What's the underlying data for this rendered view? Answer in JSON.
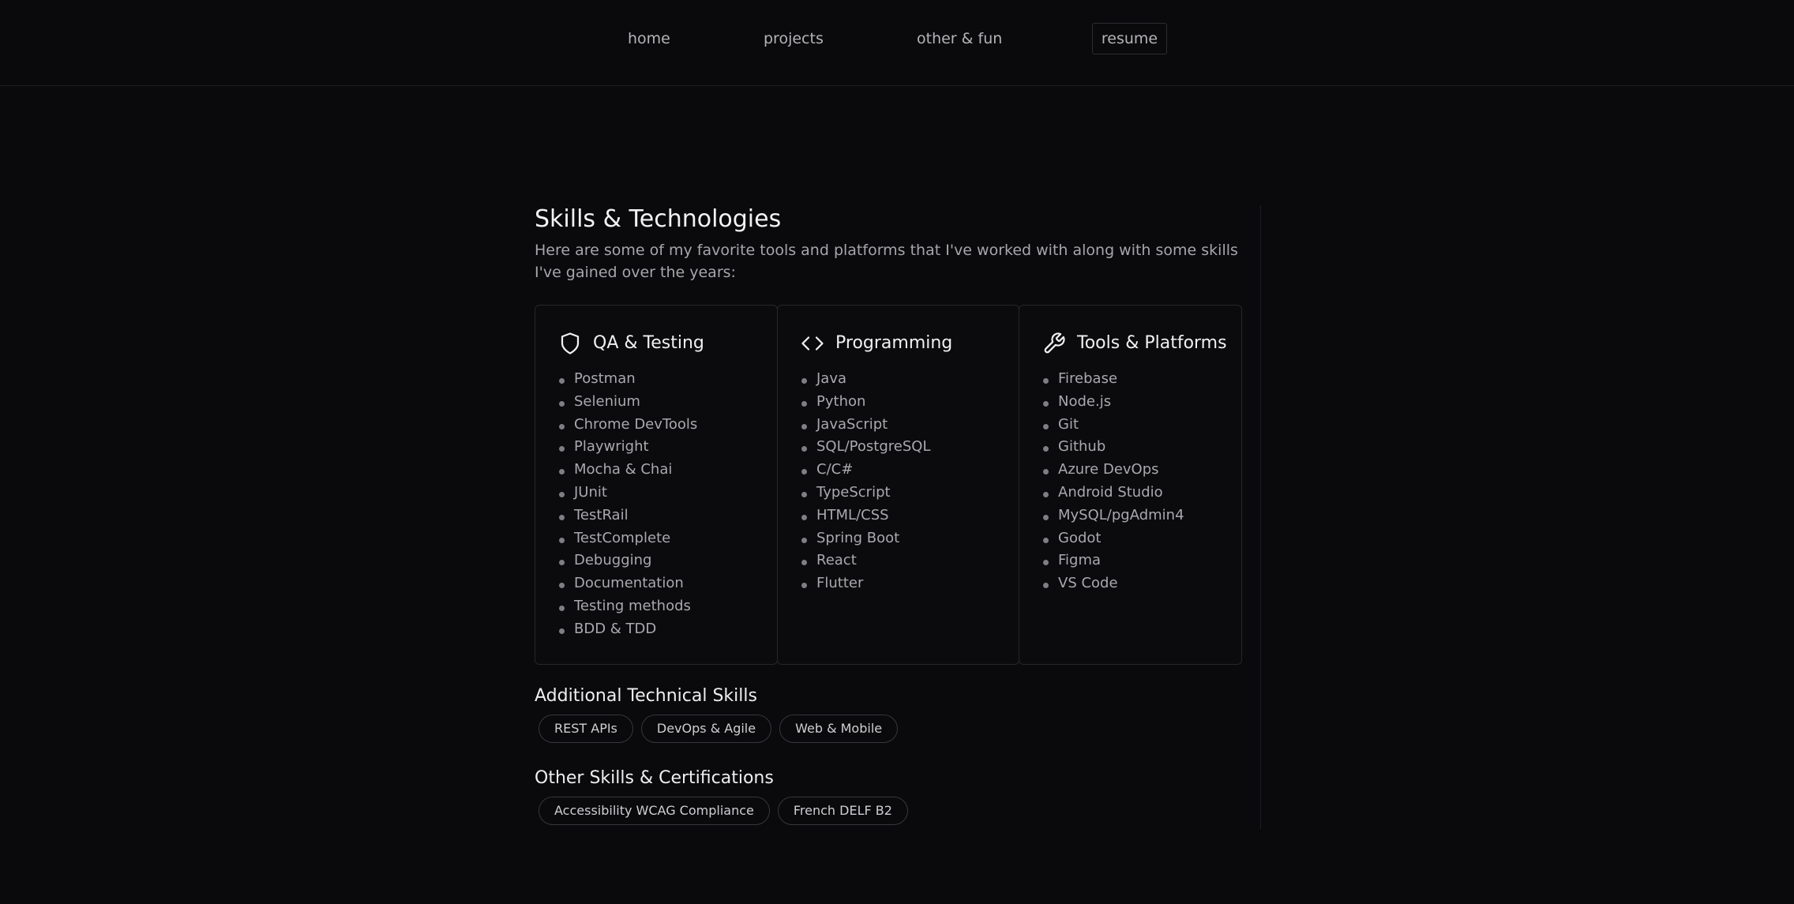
{
  "nav": {
    "home": "home",
    "projects": "projects",
    "other": "other & fun",
    "resume": "resume"
  },
  "skills": {
    "title": "Skills & Technologies",
    "description": "Here are some of my favorite tools and platforms that I've worked with along with some skills I've gained over the years:",
    "cards": [
      {
        "icon": "shield-icon",
        "title": "QA & Testing",
        "items": [
          "Postman",
          "Selenium",
          "Chrome DevTools",
          "Playwright",
          "Mocha & Chai",
          "JUnit",
          "TestRail",
          "TestComplete",
          "Debugging",
          "Documentation",
          "Testing methods",
          "BDD & TDD"
        ]
      },
      {
        "icon": "code-icon",
        "title": "Programming",
        "items": [
          "Java",
          "Python",
          "JavaScript",
          "SQL/PostgreSQL",
          "C/C#",
          "TypeScript",
          "HTML/CSS",
          "Spring Boot",
          "React",
          "Flutter"
        ]
      },
      {
        "icon": "wrench-icon",
        "title": "Tools & Platforms",
        "items": [
          "Firebase",
          "Node.js",
          "Git",
          "Github",
          "Azure DevOps",
          "Android Studio",
          "MySQL/pgAdmin4",
          "Godot",
          "Figma",
          "VS Code"
        ]
      }
    ],
    "additional": {
      "title": "Additional Technical Skills",
      "tags": [
        "REST APIs",
        "DevOps & Agile",
        "Web & Mobile"
      ]
    },
    "other": {
      "title": "Other Skills & Certifications",
      "tags": [
        "Accessibility WCAG Compliance",
        "French DELF B2"
      ]
    }
  },
  "colors": {
    "background": "#0a0a0c",
    "border": "#26262a",
    "text": "#e8e8ea",
    "muted": "#a9a9ae"
  }
}
